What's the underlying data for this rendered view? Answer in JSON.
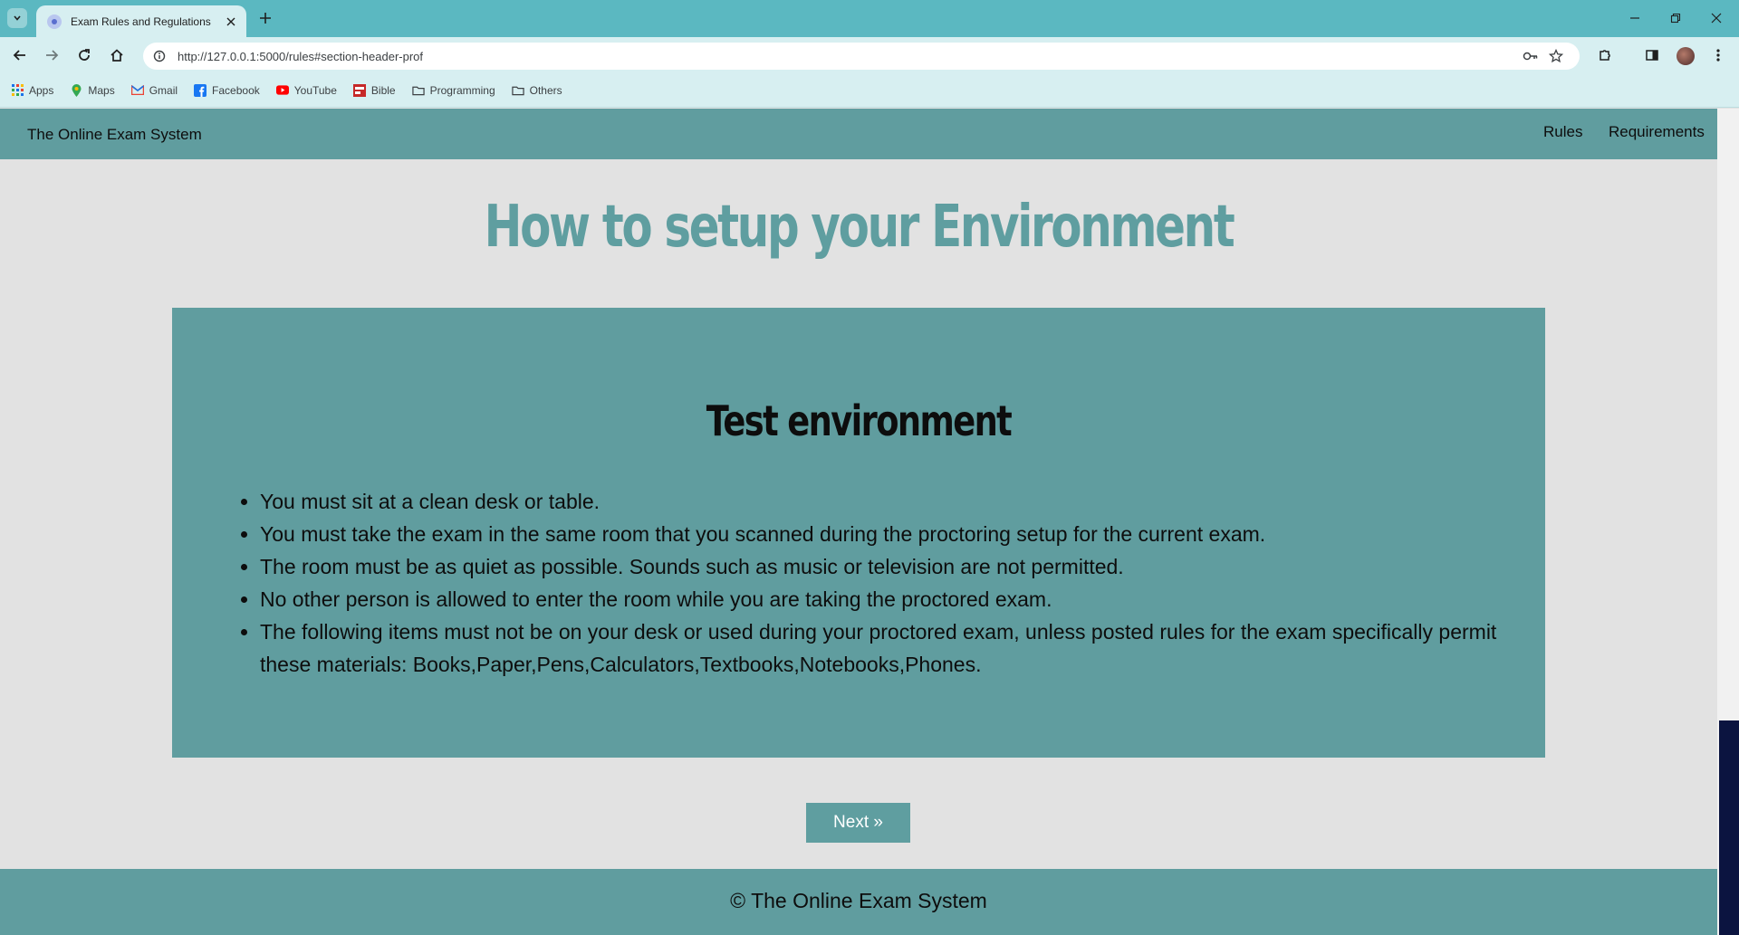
{
  "browser": {
    "tab_title": "Exam Rules and Regulations",
    "url": "http://127.0.0.1:5000/rules#section-header-prof",
    "bookmarks": [
      {
        "label": "Apps",
        "icon": "apps-grid-icon"
      },
      {
        "label": "Maps",
        "icon": "maps-pin-icon"
      },
      {
        "label": "Gmail",
        "icon": "gmail-icon"
      },
      {
        "label": "Facebook",
        "icon": "facebook-icon"
      },
      {
        "label": "YouTube",
        "icon": "youtube-icon"
      },
      {
        "label": "Bible",
        "icon": "bible-icon"
      },
      {
        "label": "Programming",
        "icon": "folder-icon"
      },
      {
        "label": "Others",
        "icon": "folder-icon"
      }
    ]
  },
  "nav": {
    "brand": "The Online Exam System",
    "links": [
      "Rules",
      "Requirements"
    ]
  },
  "main": {
    "title": "How to setup your Environment",
    "card_title": "Test environment",
    "rules": [
      "You must sit at a clean desk or table.",
      "You must take the exam in the same room that you scanned during the proctoring setup for the current exam.",
      "The room must be as quiet as possible. Sounds such as music or television are not permitted.",
      "No other person is allowed to enter the room while you are taking the proctored exam.",
      "The following items must not be on your desk or used during your proctored exam, unless posted rules for the exam specifically permit these materials: Books,Paper,Pens,Calculators,Textbooks,Notebooks,Phones."
    ],
    "next_button": "Next »"
  },
  "footer": {
    "text": "© The Online Exam System"
  },
  "colors": {
    "teal": "#609d9f",
    "title_teal": "#5f9ea0",
    "page_bg": "#e2e2e2",
    "chrome_tab_bar": "#5bb8c1",
    "chrome_toolbar": "#d7eff1"
  }
}
